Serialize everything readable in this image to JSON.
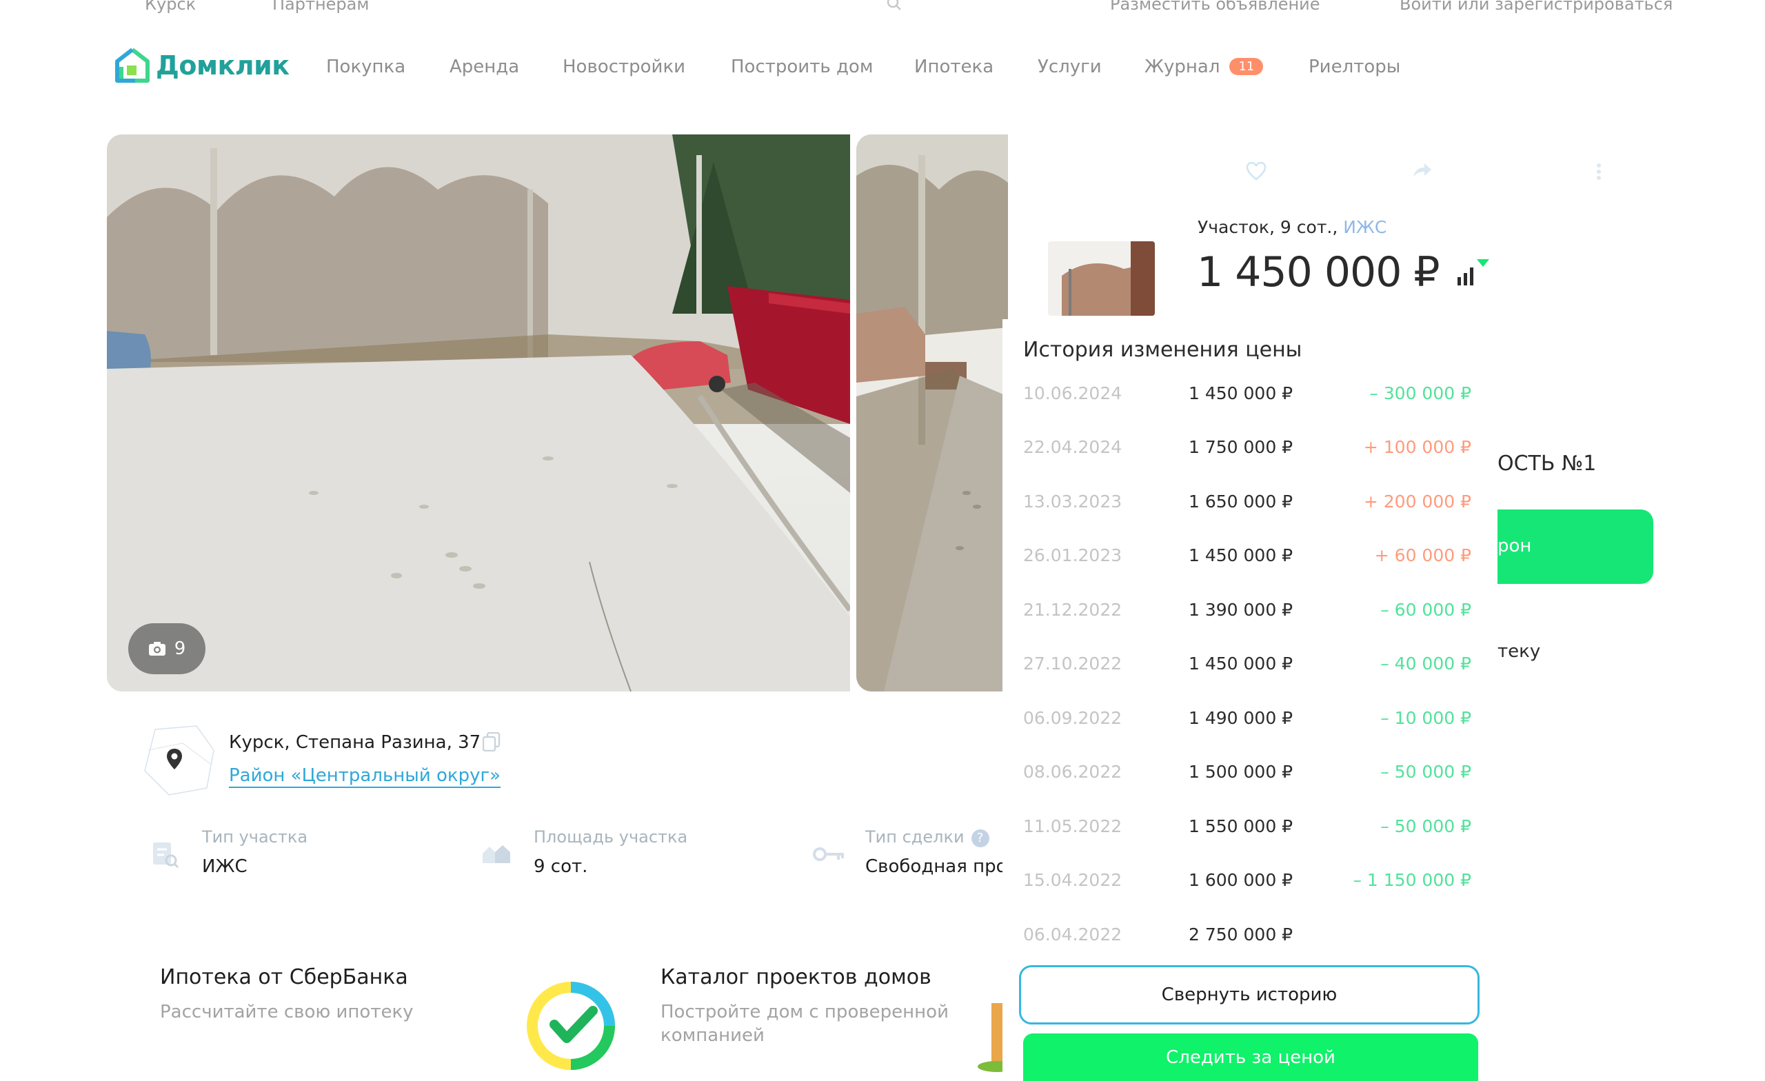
{
  "topbar": {
    "city": "Курск",
    "partners": "Партнерам",
    "post_ad": "Разместить объявление",
    "login": "Войти или зарегистрироваться"
  },
  "nav": {
    "logo": "Домклик",
    "items": [
      "Покупка",
      "Аренда",
      "Новостройки",
      "Построить дом",
      "Ипотека",
      "Услуги",
      "Журнал",
      "Риелторы"
    ],
    "journal_badge": "11"
  },
  "gallery": {
    "photo_count": "9"
  },
  "address": {
    "street": "Курск, Степана Разина, 37",
    "district": "Район «Центральный округ»"
  },
  "features": [
    {
      "label": "Тип участка",
      "value": "ИЖС"
    },
    {
      "label": "Площадь участка",
      "value": "9 сот."
    },
    {
      "label": "Тип сделки",
      "value": "Свободная про"
    }
  ],
  "promos": [
    {
      "title": "Ипотека от СберБанка",
      "subtitle": "Рассчитайте свою ипотеку"
    },
    {
      "title": "Каталог проектов домов",
      "subtitle_line1": "Постройте дом с проверенной",
      "subtitle_line2": "компанией"
    }
  ],
  "listing": {
    "type_prefix": "Участок, 9 сот.,",
    "type_link": "ИЖС",
    "price": "1 450 000 ₽",
    "partial_heading": "ОСТЬ №1",
    "partial_button": "рон",
    "partial_link": "теку"
  },
  "history": {
    "title": "История изменения цены",
    "rows": [
      {
        "date": "10.06.2024",
        "price": "1 450 000 ₽",
        "delta": "– 300 000 ₽",
        "dir": "down"
      },
      {
        "date": "22.04.2024",
        "price": "1 750 000 ₽",
        "delta": "+ 100 000 ₽",
        "dir": "up"
      },
      {
        "date": "13.03.2023",
        "price": "1 650 000 ₽",
        "delta": "+ 200 000 ₽",
        "dir": "up"
      },
      {
        "date": "26.01.2023",
        "price": "1 450 000 ₽",
        "delta": "+ 60 000 ₽",
        "dir": "up"
      },
      {
        "date": "21.12.2022",
        "price": "1 390 000 ₽",
        "delta": "– 60 000 ₽",
        "dir": "down"
      },
      {
        "date": "27.10.2022",
        "price": "1 450 000 ₽",
        "delta": "– 40 000 ₽",
        "dir": "down"
      },
      {
        "date": "06.09.2022",
        "price": "1 490 000 ₽",
        "delta": "– 10 000 ₽",
        "dir": "down"
      },
      {
        "date": "08.06.2022",
        "price": "1 500 000 ₽",
        "delta": "– 50 000 ₽",
        "dir": "down"
      },
      {
        "date": "11.05.2022",
        "price": "1 550 000 ₽",
        "delta": "– 50 000 ₽",
        "dir": "down"
      },
      {
        "date": "15.04.2022",
        "price": "1 600 000 ₽",
        "delta": "– 1 150 000 ₽",
        "dir": "down"
      },
      {
        "date": "06.04.2022",
        "price": "2 750 000 ₽",
        "delta": "",
        "dir": "none"
      }
    ],
    "collapse_label": "Свернуть историю",
    "follow_label": "Следить за ценой"
  },
  "colors": {
    "brand": "#21a19a",
    "accent_green": "#0ff26a",
    "link_blue": "#2ea8d8",
    "delta_down": "#52e29a",
    "delta_up": "#ff9b7c"
  }
}
